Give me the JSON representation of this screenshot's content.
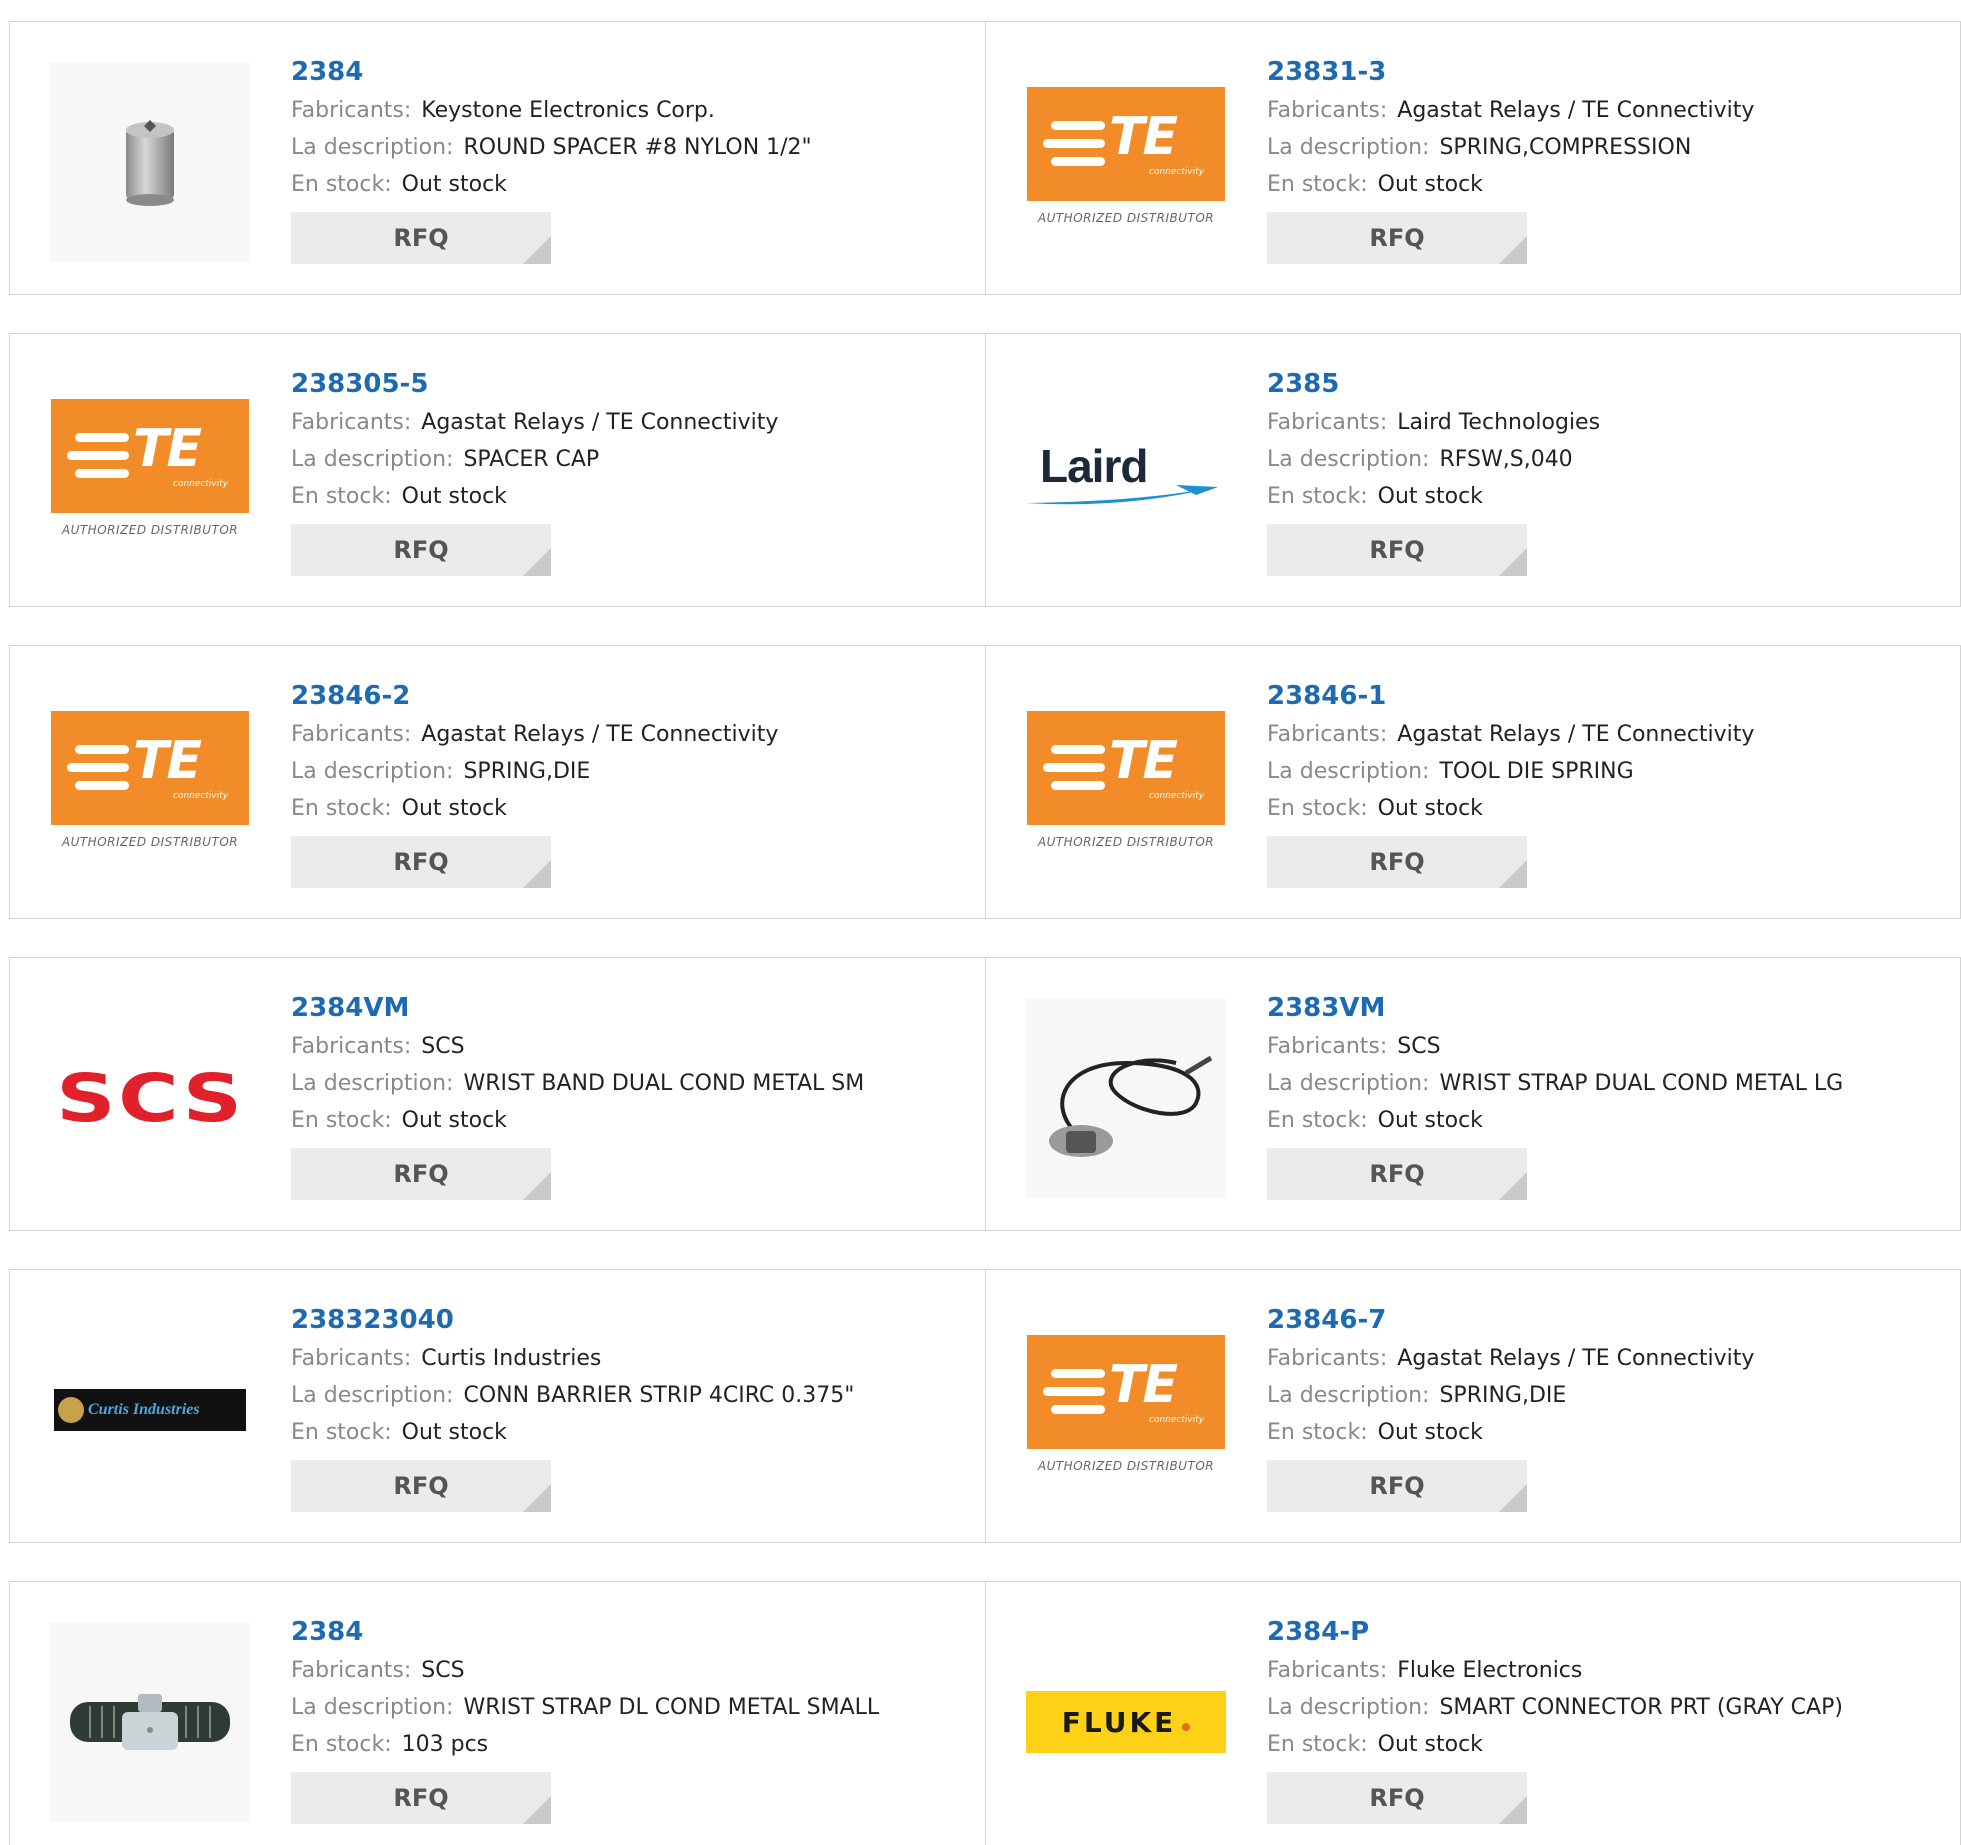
{
  "labels": {
    "manufacturer": "Fabricants:",
    "description": "La description:",
    "stock": "En stock:",
    "rfq": "RFQ"
  },
  "products": [
    {
      "part": "2384",
      "manufacturer": "Keystone Electronics Corp.",
      "description": "ROUND SPACER #8 NYLON 1/2\"",
      "stock": "Out stock",
      "image": "spacer-photo"
    },
    {
      "part": "23831-3",
      "manufacturer": "Agastat Relays / TE Connectivity",
      "description": "SPRING,COMPRESSION",
      "stock": "Out stock",
      "image": "te-logo"
    },
    {
      "part": "238305-5",
      "manufacturer": "Agastat Relays / TE Connectivity",
      "description": "SPACER CAP",
      "stock": "Out stock",
      "image": "te-logo"
    },
    {
      "part": "2385",
      "manufacturer": "Laird Technologies",
      "description": "RFSW,S,040",
      "stock": "Out stock",
      "image": "laird-logo"
    },
    {
      "part": "23846-2",
      "manufacturer": "Agastat Relays / TE Connectivity",
      "description": "SPRING,DIE",
      "stock": "Out stock",
      "image": "te-logo"
    },
    {
      "part": "23846-1",
      "manufacturer": "Agastat Relays / TE Connectivity",
      "description": "TOOL DIE SPRING",
      "stock": "Out stock",
      "image": "te-logo"
    },
    {
      "part": "2384VM",
      "manufacturer": "SCS",
      "description": "WRIST BAND DUAL COND METAL SM",
      "stock": "Out stock",
      "image": "scs-logo"
    },
    {
      "part": "2383VM",
      "manufacturer": "SCS",
      "description": "WRIST STRAP DUAL COND METAL LG",
      "stock": "Out stock",
      "image": "wrist-strap-photo"
    },
    {
      "part": "238323040",
      "manufacturer": "Curtis Industries",
      "description": "CONN BARRIER STRIP 4CIRC 0.375\"",
      "stock": "Out stock",
      "image": "curtis-logo"
    },
    {
      "part": "23846-7",
      "manufacturer": "Agastat Relays / TE Connectivity",
      "description": "SPRING,DIE",
      "stock": "Out stock",
      "image": "te-logo"
    },
    {
      "part": "2384",
      "manufacturer": "SCS",
      "description": "WRIST STRAP DL COND METAL SMALL",
      "stock": "103 pcs",
      "image": "wrist-band-photo"
    },
    {
      "part": "2384-P",
      "manufacturer": "Fluke Electronics",
      "description": "SMART CONNECTOR PRT (GRAY CAP)",
      "stock": "Out stock",
      "image": "fluke-logo"
    }
  ],
  "logos": {
    "te_word": "TE",
    "te_sub": "connectivity",
    "te_tagline": "AUTHORIZED DISTRIBUTOR",
    "laird_word": "Laird",
    "scs_word": "SCS",
    "curtis_word": "Curtis Industries",
    "fluke_word": "FLUKE"
  },
  "colors": {
    "link": "#1e6ab0",
    "te_orange": "#f28c28",
    "scs_red": "#e0202a",
    "fluke_yellow": "#fcd116"
  }
}
